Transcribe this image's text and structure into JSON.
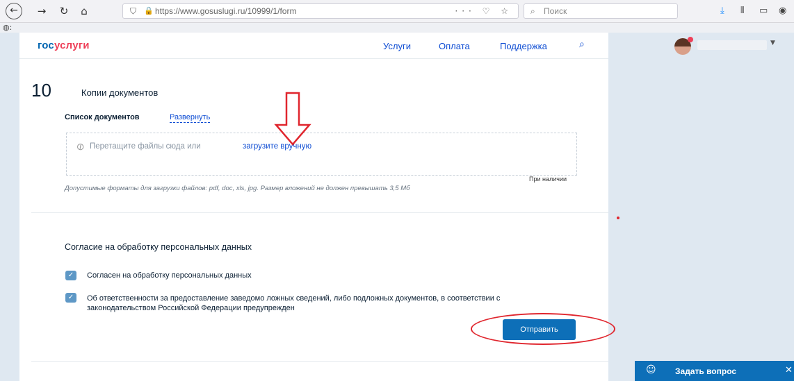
{
  "browser": {
    "url": "https://www.gosuslugi.ru/10999/1/form",
    "search_placeholder": "Поиск",
    "url_actions": "··· ♡ ☆"
  },
  "header": {
    "logo_part1": "гос",
    "logo_part2": "услуги",
    "nav": [
      "Услуги",
      "Оплата",
      "Поддержка"
    ]
  },
  "step": {
    "number": "10",
    "title": "Копии документов",
    "doc_list_label": "Список документов",
    "expand_link": "Развернуть",
    "drop_text": "Перетащите файлы сюда или",
    "upload_link": "загрузите вручную",
    "if_available": "При наличии",
    "formats_note": "Допустимые форматы для загрузки файлов: pdf, doc, xls, jpg. Размер вложений не должен превышать 3,5 Мб"
  },
  "consent": {
    "title": "Согласие на обработку персональных данных",
    "items": [
      {
        "label": "Согласен на обработку персональных данных",
        "checked": true
      },
      {
        "label": "Об ответственности за предоставление заведомо ложных сведений, либо подложных документов, в соответствии с законодательством Российской Федерации предупрежден",
        "checked": true
      }
    ],
    "submit_label": "Отправить"
  },
  "help": {
    "ask_label": "Задать вопрос"
  },
  "colors": {
    "brand_blue": "#0065b1",
    "brand_red": "#ee3f58",
    "link": "#0d4cd3",
    "button": "#0d6fb8",
    "annotation_red": "#e0262e"
  }
}
